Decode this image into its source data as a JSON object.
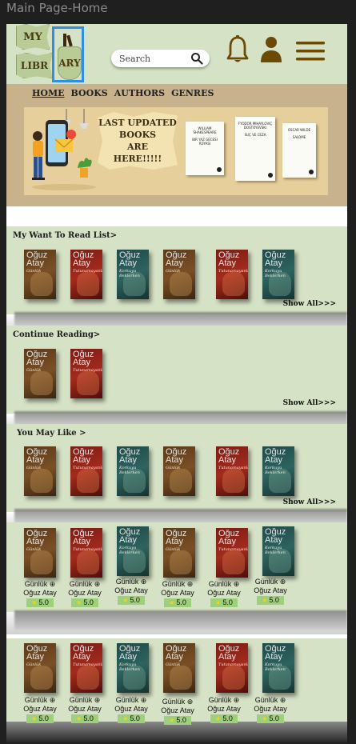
{
  "window": {
    "title": "Main Page-Home"
  },
  "logo": {
    "part1": "MY",
    "part2": "LIBR",
    "part3": "ARY"
  },
  "search": {
    "placeholder": "Search"
  },
  "icons": {
    "bell": "bell-icon",
    "user": "user-icon",
    "menu": "hamburger-menu-icon",
    "search": "search-icon",
    "star": "star-icon"
  },
  "nav": {
    "items": [
      "HOME",
      "BOOKS",
      "AUTHORS",
      "GENRES"
    ],
    "active": "HOME"
  },
  "hero": {
    "caption_lines": [
      "LAST UPDATED",
      "BOOKS",
      "ARE",
      "HERE!!!!!"
    ],
    "books": [
      {
        "author": "WILLIAM SHAKESPEARE",
        "title": "BIR YAZ GECESI RÜYASI"
      },
      {
        "author": "FYODOR MIHAYLOVIÇ DOSTOYEVSKI",
        "title": "SUÇ VE CEZA"
      },
      {
        "author": "OSCAR WILDE",
        "title": "SALOME"
      }
    ]
  },
  "sections": {
    "want_to_read": {
      "title": "My Want To Read List>",
      "show_all": "Show All>>>"
    },
    "continue_reading": {
      "title": "Continue Reading>",
      "show_all": "Show All>>>"
    },
    "you_may_like": {
      "title": "You May Like >",
      "show_all": "Show All>>>"
    }
  },
  "covers": {
    "author": [
      "Oğuz",
      "Atay"
    ],
    "c1": "Günlük",
    "c2": "Tutunamayanlar",
    "c3": "Korkuyu Beklerken"
  },
  "rated_card": {
    "title": "Günlük",
    "plus": "⊕",
    "author": "Oğuz Atay",
    "rating": "5.0"
  },
  "colors": {
    "accent_green": "#d6e2c5",
    "banner_tan": "#c7b28c",
    "icon_brown": "#6b4a06",
    "rating_green": "#9ecf7a"
  }
}
